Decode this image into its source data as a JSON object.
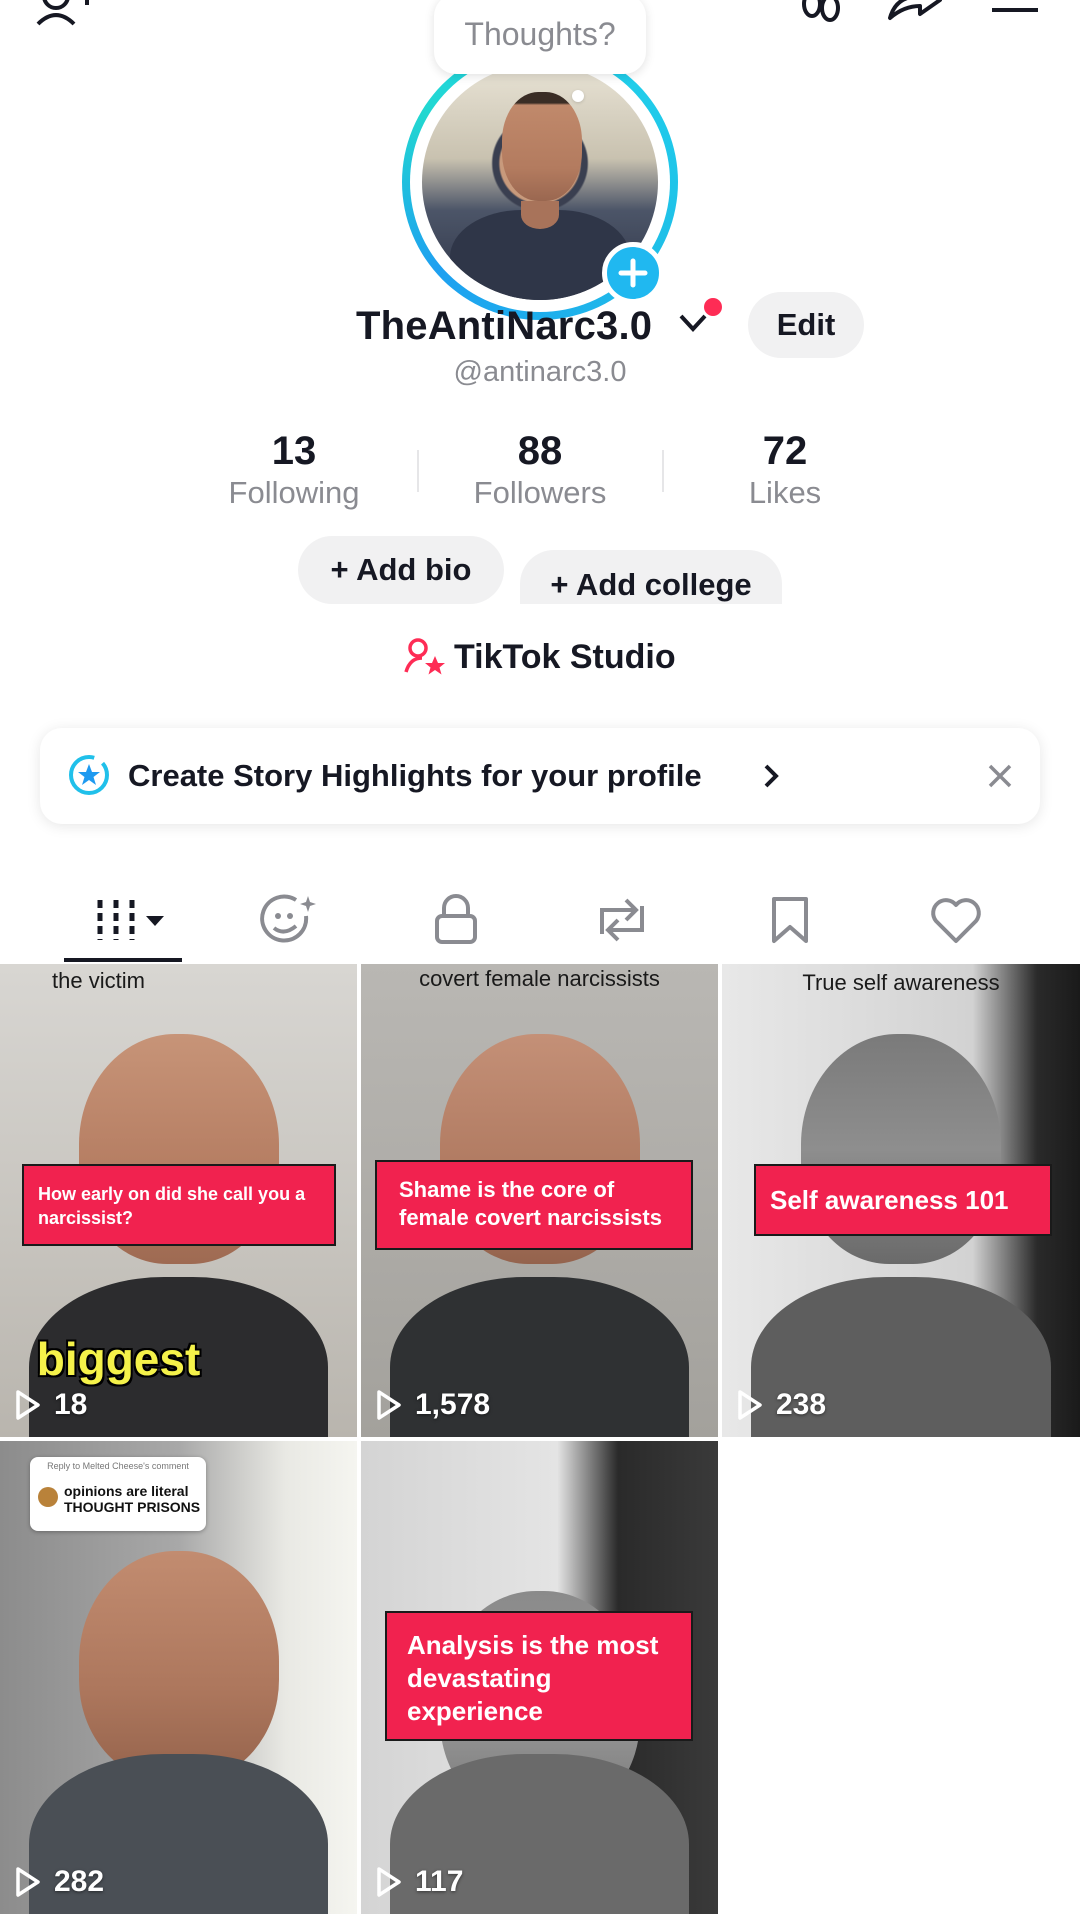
{
  "top_bar": {
    "add_friend_icon": "person-plus-icon",
    "footprints_icon": "footprint-icon",
    "share_icon": "share-arrow-icon",
    "menu_icon": "hamburger-menu-icon"
  },
  "profile": {
    "thought_bubble": "Thoughts?",
    "display_name": "TheAntiNarc3.0",
    "handle": "@antinarc3.0",
    "edit_label": "Edit",
    "accent_color": "#20d5ec",
    "notification_color": "#fe2c55"
  },
  "stats": [
    {
      "value": "13",
      "label": "Following"
    },
    {
      "value": "88",
      "label": "Followers"
    },
    {
      "value": "72",
      "label": "Likes"
    }
  ],
  "actions": {
    "add_bio": "+ Add bio",
    "add_college": "+ Add college",
    "studio": "TikTok Studio"
  },
  "banner": {
    "text": "Create Story Highlights for your profile"
  },
  "tabs": [
    "videos-grid-icon",
    "stories-face-icon",
    "private-lock-icon",
    "reposts-icon",
    "favorites-bookmark-icon",
    "liked-heart-icon"
  ],
  "videos": [
    {
      "top_caption": "the victim",
      "overlay": "How early on did she call you a narcissist?",
      "caption": "biggest",
      "views": "18"
    },
    {
      "top_caption": "covert female narcissists",
      "overlay": "Shame is the core of female covert narcissists",
      "caption": "",
      "views": "1,578"
    },
    {
      "top_caption": "True self awareness",
      "overlay": "Self awareness 101",
      "caption": "",
      "views": "238"
    },
    {
      "top_caption": "",
      "overlay": "",
      "comment_small": "Reply to Melted Cheese's comment",
      "comment_big": "opinions are literal THOUGHT PRISONS",
      "views": "282"
    },
    {
      "top_caption": "",
      "overlay": "Analysis is the most devastating experience",
      "caption": "",
      "views": "117"
    }
  ]
}
